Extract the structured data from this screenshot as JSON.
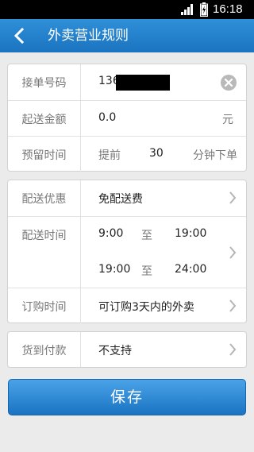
{
  "status_bar": {
    "time": "16:18"
  },
  "header": {
    "title": "外卖营业规则"
  },
  "form": {
    "phone": {
      "label": "接单号码",
      "value": "136"
    },
    "min_amount": {
      "label": "起送金额",
      "value": "0.0",
      "unit": "元"
    },
    "reserve": {
      "label": "预留时间",
      "prefix": "提前",
      "value": "30",
      "suffix": "分钟下单"
    },
    "delivery_discount": {
      "label": "配送优惠",
      "value": "免配送费"
    },
    "delivery_time": {
      "label": "配送时间",
      "ranges": [
        {
          "start": "9:00",
          "sep": "至",
          "end": "19:00"
        },
        {
          "start": "19:00",
          "sep": "至",
          "end": "24:00"
        }
      ]
    },
    "order_time": {
      "label": "订购时间",
      "value": "可订购3天内的外卖"
    },
    "cod": {
      "label": "货到付款",
      "value": "不支持"
    }
  },
  "save_label": "保存",
  "colors": {
    "header": "#1f7cc8",
    "accent": "#2a8ad6"
  }
}
